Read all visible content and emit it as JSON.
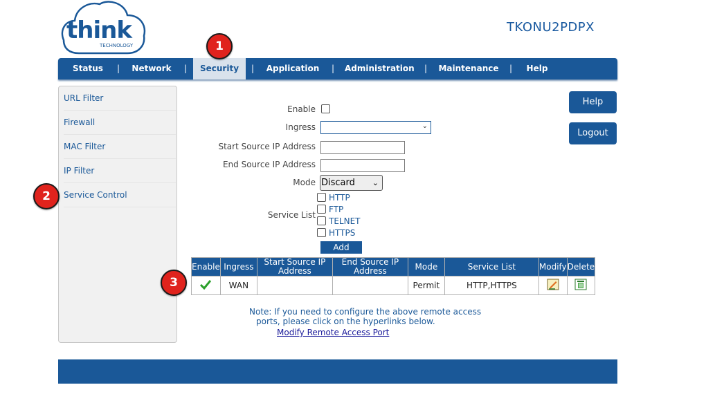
{
  "brand": {
    "logo_text": "think",
    "logo_subtext": "TECHNOLOGY"
  },
  "device_name": "TKONU2PDPX",
  "nav": {
    "items": [
      {
        "label": "Status"
      },
      {
        "label": "Network"
      },
      {
        "label": "Security"
      },
      {
        "label": "Application"
      },
      {
        "label": "Administration"
      },
      {
        "label": "Maintenance"
      },
      {
        "label": "Help"
      }
    ],
    "separator": "|",
    "active": "Security"
  },
  "sidebar": {
    "items": [
      {
        "label": "URL Filter"
      },
      {
        "label": "Firewall"
      },
      {
        "label": "MAC Filter"
      },
      {
        "label": "IP Filter"
      },
      {
        "label": "Service Control"
      }
    ]
  },
  "buttons": {
    "help": "Help",
    "logout": "Logout",
    "add": "Add"
  },
  "form": {
    "enable_label": "Enable",
    "enable_checked": false,
    "ingress_label": "Ingress",
    "ingress_value": "",
    "start_ip_label": "Start Source IP Address",
    "start_ip_value": "",
    "end_ip_label": "End Source IP Address",
    "end_ip_value": "",
    "mode_label": "Mode",
    "mode_value": "Discard",
    "service_list_label": "Service List",
    "services": [
      {
        "label": "HTTP",
        "checked": false
      },
      {
        "label": "FTP",
        "checked": false
      },
      {
        "label": "TELNET",
        "checked": false
      },
      {
        "label": "HTTPS",
        "checked": false
      }
    ]
  },
  "table": {
    "headers": {
      "enable": "Enable",
      "ingress": "Ingress",
      "start_ip_line1": "Start Source IP",
      "start_ip_line2": "Address",
      "end_ip_line1": "End Source IP",
      "end_ip_line2": "Address",
      "mode": "Mode",
      "service_list": "Service List",
      "modify": "Modify",
      "delete": "Delete"
    },
    "rows": [
      {
        "enabled": true,
        "ingress": "WAN",
        "start_ip": "",
        "end_ip": "",
        "mode": "Permit",
        "service_list": "HTTP,HTTPS"
      }
    ]
  },
  "note": {
    "line1": "Note: If you need to configure the above remote access",
    "line2": "ports, please click on the hyperlinks below.",
    "link": "Modify Remote Access Port"
  },
  "markers": [
    "1",
    "2",
    "3"
  ],
  "colors": {
    "primary": "#1a5898",
    "marker": "#e0231d",
    "check": "#2aa02a"
  }
}
